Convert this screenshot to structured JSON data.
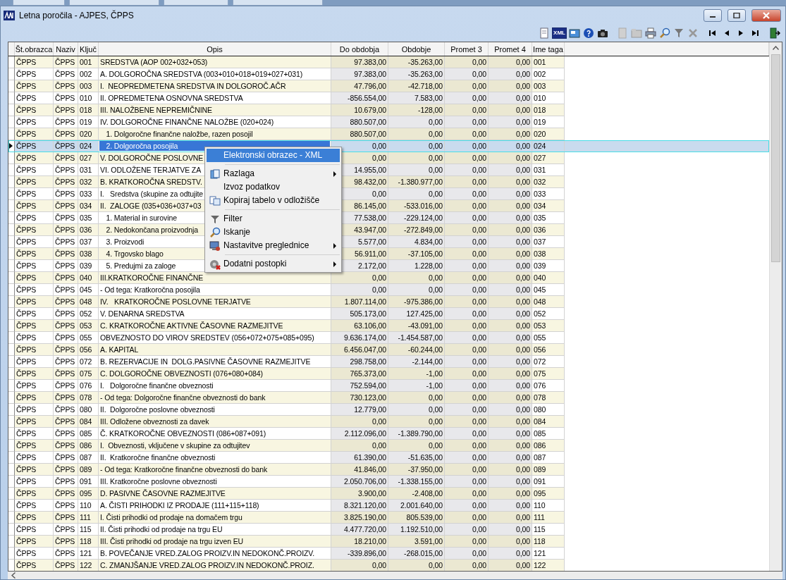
{
  "window": {
    "title": "Letna poročila - AJPES, ČPPS"
  },
  "toolbar": {
    "xml_badge": "XML"
  },
  "table": {
    "columns": [
      "Št.obrazca",
      "Naziv",
      "Ključ",
      "Opis",
      "Do obdobja",
      "Obdobje",
      "Promet 3",
      "Promet 4",
      "Ime taga"
    ],
    "rows": [
      {
        "cells": [
          "ČPPS",
          "ČPPS",
          "001",
          "SREDSTVA (AOP 002+032+053)",
          "97.383,00",
          "-35.263,00",
          "0,00",
          "0,00",
          "001"
        ],
        "selected": false
      },
      {
        "cells": [
          "ČPPS",
          "ČPPS",
          "002",
          "A. DOLGOROČNA SREDSTVA (003+010+018+019+027+031)",
          "97.383,00",
          "-35.263,00",
          "0,00",
          "0,00",
          "002"
        ],
        "selected": false
      },
      {
        "cells": [
          "ČPPS",
          "ČPPS",
          "003",
          "I.  NEOPREDMETENA SREDSTVA IN DOLGOROČ.AČR",
          "47.796,00",
          "-42.718,00",
          "0,00",
          "0,00",
          "003"
        ],
        "selected": false
      },
      {
        "cells": [
          "ČPPS",
          "ČPPS",
          "010",
          "II. OPREDMETENA OSNOVNA SREDSTVA",
          "-856.554,00",
          "7.583,00",
          "0,00",
          "0,00",
          "010"
        ],
        "selected": false
      },
      {
        "cells": [
          "ČPPS",
          "ČPPS",
          "018",
          "III. NALOŽBENE NEPREMIČNINE",
          "10.679,00",
          "-128,00",
          "0,00",
          "0,00",
          "018"
        ],
        "selected": false
      },
      {
        "cells": [
          "ČPPS",
          "ČPPS",
          "019",
          "IV. DOLGOROČNE FINANČNE NALOŽBE (020+024)",
          "880.507,00",
          "0,00",
          "0,00",
          "0,00",
          "019"
        ],
        "selected": false
      },
      {
        "cells": [
          "ČPPS",
          "ČPPS",
          "020",
          "   1. Dolgoročne finančne naložbe, razen posojil",
          "880.507,00",
          "0,00",
          "0,00",
          "0,00",
          "020"
        ],
        "selected": false
      },
      {
        "cells": [
          "ČPPS",
          "ČPPS",
          "024",
          "   2. Dolgoročna posojila",
          "0,00",
          "0,00",
          "0,00",
          "0,00",
          "024"
        ],
        "selected": true
      },
      {
        "cells": [
          "ČPPS",
          "ČPPS",
          "027",
          "V. DOLGOROČNE POSLOVNE",
          "0,00",
          "0,00",
          "0,00",
          "0,00",
          "027"
        ],
        "selected": false
      },
      {
        "cells": [
          "ČPPS",
          "ČPPS",
          "031",
          "VI. ODLOŽENE TERJATVE ZA",
          "14.955,00",
          "0,00",
          "0,00",
          "0,00",
          "031"
        ],
        "selected": false
      },
      {
        "cells": [
          "ČPPS",
          "ČPPS",
          "032",
          "B. KRATKOROČNA SREDSTV.",
          "98.432,00",
          "-1.380.977,00",
          "0,00",
          "0,00",
          "032"
        ],
        "selected": false
      },
      {
        "cells": [
          "ČPPS",
          "ČPPS",
          "033",
          "I.   Sredstva (skupine za odtujite",
          "0,00",
          "0,00",
          "0,00",
          "0,00",
          "033"
        ],
        "selected": false
      },
      {
        "cells": [
          "ČPPS",
          "ČPPS",
          "034",
          "II.  ZALOGE (035+036+037+03",
          "86.145,00",
          "-533.016,00",
          "0,00",
          "0,00",
          "034"
        ],
        "selected": false
      },
      {
        "cells": [
          "ČPPS",
          "ČPPS",
          "035",
          "   1. Material in surovine",
          "77.538,00",
          "-229.124,00",
          "0,00",
          "0,00",
          "035"
        ],
        "selected": false
      },
      {
        "cells": [
          "ČPPS",
          "ČPPS",
          "036",
          "   2. Nedokončana proizvodnja",
          "43.947,00",
          "-272.849,00",
          "0,00",
          "0,00",
          "036"
        ],
        "selected": false
      },
      {
        "cells": [
          "ČPPS",
          "ČPPS",
          "037",
          "   3. Proizvodi",
          "5.577,00",
          "4.834,00",
          "0,00",
          "0,00",
          "037"
        ],
        "selected": false
      },
      {
        "cells": [
          "ČPPS",
          "ČPPS",
          "038",
          "   4. Trgovsko blago",
          "56.911,00",
          "-37.105,00",
          "0,00",
          "0,00",
          "038"
        ],
        "selected": false
      },
      {
        "cells": [
          "ČPPS",
          "ČPPS",
          "039",
          "   5. Predujmi za zaloge",
          "2.172,00",
          "1.228,00",
          "0,00",
          "0,00",
          "039"
        ],
        "selected": false
      },
      {
        "cells": [
          "ČPPS",
          "ČPPS",
          "040",
          "III.KRATKOROČNE FINANČNE",
          "0,00",
          "0,00",
          "0,00",
          "0,00",
          "040"
        ],
        "selected": false
      },
      {
        "cells": [
          "ČPPS",
          "ČPPS",
          "045",
          "- Od tega: Kratkoročna posojila",
          "0,00",
          "0,00",
          "0,00",
          "0,00",
          "045"
        ],
        "selected": false
      },
      {
        "cells": [
          "ČPPS",
          "ČPPS",
          "048",
          "IV.   KRATKOROČNE POSLOVNE TERJATVE",
          "1.807.114,00",
          "-975.386,00",
          "0,00",
          "0,00",
          "048"
        ],
        "selected": false
      },
      {
        "cells": [
          "ČPPS",
          "ČPPS",
          "052",
          "V. DENARNA SREDSTVA",
          "505.173,00",
          "127.425,00",
          "0,00",
          "0,00",
          "052"
        ],
        "selected": false
      },
      {
        "cells": [
          "ČPPS",
          "ČPPS",
          "053",
          "C. KRATKOROČNE AKTIVNE ČASOVNE RAZMEJITVE",
          "63.106,00",
          "-43.091,00",
          "0,00",
          "0,00",
          "053"
        ],
        "selected": false
      },
      {
        "cells": [
          "ČPPS",
          "ČPPS",
          "055",
          "OBVEZNOSTO DO VIROV SREDSTEV (056+072+075+085+095)",
          "9.636.174,00",
          "-1.454.587,00",
          "0,00",
          "0,00",
          "055"
        ],
        "selected": false
      },
      {
        "cells": [
          "ČPPS",
          "ČPPS",
          "056",
          "A. KAPITAL",
          "6.456.047,00",
          "-60.244,00",
          "0,00",
          "0,00",
          "056"
        ],
        "selected": false
      },
      {
        "cells": [
          "ČPPS",
          "ČPPS",
          "072",
          "B. REZERVACIJE IN  DOLG.PASIVNE ČASOVNE RAZMEJITVE",
          "298.758,00",
          "-2.144,00",
          "0,00",
          "0,00",
          "072"
        ],
        "selected": false
      },
      {
        "cells": [
          "ČPPS",
          "ČPPS",
          "075",
          "C. DOLGOROČNE OBVEZNOSTI (076+080+084)",
          "765.373,00",
          "-1,00",
          "0,00",
          "0,00",
          "075"
        ],
        "selected": false
      },
      {
        "cells": [
          "ČPPS",
          "ČPPS",
          "076",
          "I.   Dolgoročne finančne obveznosti",
          "752.594,00",
          "-1,00",
          "0,00",
          "0,00",
          "076"
        ],
        "selected": false
      },
      {
        "cells": [
          "ČPPS",
          "ČPPS",
          "078",
          "- Od tega: Dolgoročne finančne obveznosti do bank",
          "730.123,00",
          "0,00",
          "0,00",
          "0,00",
          "078"
        ],
        "selected": false
      },
      {
        "cells": [
          "ČPPS",
          "ČPPS",
          "080",
          "II.  Dolgoročne poslovne obveznosti",
          "12.779,00",
          "0,00",
          "0,00",
          "0,00",
          "080"
        ],
        "selected": false
      },
      {
        "cells": [
          "ČPPS",
          "ČPPS",
          "084",
          "III. Odložene obveznosti za davek",
          "0,00",
          "0,00",
          "0,00",
          "0,00",
          "084"
        ],
        "selected": false
      },
      {
        "cells": [
          "ČPPS",
          "ČPPS",
          "085",
          "Č. KRATKOROČNE OBVEZNOSTI (086+087+091)",
          "2.112.096,00",
          "-1.389.790,00",
          "0,00",
          "0,00",
          "085"
        ],
        "selected": false
      },
      {
        "cells": [
          "ČPPS",
          "ČPPS",
          "086",
          "I.  Obveznosti, vključene v skupine za odtujitev",
          "0,00",
          "0,00",
          "0,00",
          "0,00",
          "086"
        ],
        "selected": false
      },
      {
        "cells": [
          "ČPPS",
          "ČPPS",
          "087",
          "II.  Kratkoročne finančne obveznosti",
          "61.390,00",
          "-51.635,00",
          "0,00",
          "0,00",
          "087"
        ],
        "selected": false
      },
      {
        "cells": [
          "ČPPS",
          "ČPPS",
          "089",
          "- Od tega: Kratkoročne finančne obveznosti do bank",
          "41.846,00",
          "-37.950,00",
          "0,00",
          "0,00",
          "089"
        ],
        "selected": false
      },
      {
        "cells": [
          "ČPPS",
          "ČPPS",
          "091",
          "III. Kratkoročne poslovne obveznosti",
          "2.050.706,00",
          "-1.338.155,00",
          "0,00",
          "0,00",
          "091"
        ],
        "selected": false
      },
      {
        "cells": [
          "ČPPS",
          "ČPPS",
          "095",
          "D. PASIVNE ČASOVNE RAZMEJITVE",
          "3.900,00",
          "-2.408,00",
          "0,00",
          "0,00",
          "095"
        ],
        "selected": false
      },
      {
        "cells": [
          "ČPPS",
          "ČPPS",
          "110",
          "A. ČISTI PRIHODKI IZ PRODAJE (111+115+118)",
          "8.321.120,00",
          "2.001.640,00",
          "0,00",
          "0,00",
          "110"
        ],
        "selected": false
      },
      {
        "cells": [
          "ČPPS",
          "ČPPS",
          "111",
          "I. Čisti prihodki od prodaje na domačem trgu",
          "3.825.190,00",
          "805.539,00",
          "0,00",
          "0,00",
          "111"
        ],
        "selected": false
      },
      {
        "cells": [
          "ČPPS",
          "ČPPS",
          "115",
          "II. Čisti prihodki od prodaje na trgu EU",
          "4.477.720,00",
          "1.192.510,00",
          "0,00",
          "0,00",
          "115"
        ],
        "selected": false
      },
      {
        "cells": [
          "ČPPS",
          "ČPPS",
          "118",
          "III. Čisti prihodki od prodaje na trgu izven EU",
          "18.210,00",
          "3.591,00",
          "0,00",
          "0,00",
          "118"
        ],
        "selected": false
      },
      {
        "cells": [
          "ČPPS",
          "ČPPS",
          "121",
          "B. POVEČANJE VRED.ZALOG PROIZV.IN NEDOKONČ.PROIZV.",
          "-339.896,00",
          "-268.015,00",
          "0,00",
          "0,00",
          "121"
        ],
        "selected": false
      },
      {
        "cells": [
          "ČPPS",
          "ČPPS",
          "122",
          "C. ZMANJŠANJE VRED.ZALOG PROIZV.IN NEDOKONČ.PROIZ.",
          "0,00",
          "0,00",
          "0,00",
          "0,00",
          "122"
        ],
        "selected": false
      }
    ]
  },
  "context_menu": {
    "items": [
      {
        "kind": "item",
        "label": "Elektronski obrazec - XML",
        "selected": true,
        "submenu": false
      },
      {
        "kind": "separator"
      },
      {
        "kind": "item",
        "label": "Razlaga",
        "selected": false,
        "submenu": true
      },
      {
        "kind": "item",
        "label": "Izvoz podatkov",
        "selected": false,
        "submenu": false
      },
      {
        "kind": "item",
        "label": "Kopiraj tabelo v odložišče",
        "selected": false,
        "submenu": false
      },
      {
        "kind": "separator"
      },
      {
        "kind": "item",
        "label": "Filter",
        "selected": false,
        "submenu": false
      },
      {
        "kind": "item",
        "label": "Iskanje",
        "selected": false,
        "submenu": false
      },
      {
        "kind": "item",
        "label": "Nastavitve preglednice",
        "selected": false,
        "submenu": true
      },
      {
        "kind": "separator"
      },
      {
        "kind": "item",
        "label": "Dodatni postopki",
        "selected": false,
        "submenu": true
      }
    ]
  }
}
